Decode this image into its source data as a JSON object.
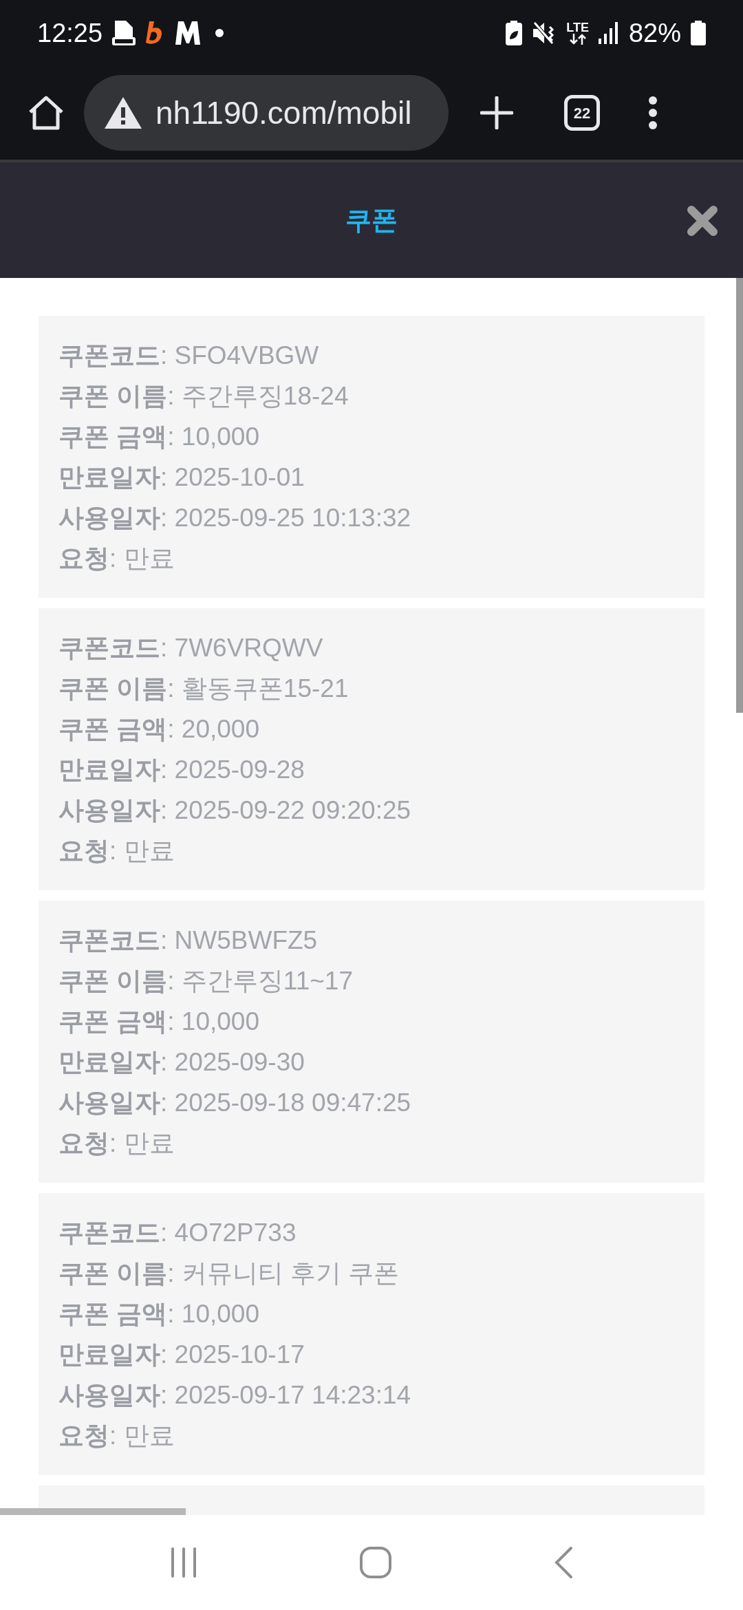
{
  "status_bar": {
    "time": "12:25",
    "network": "LTE",
    "battery": "82%"
  },
  "browser": {
    "url": "nh1190.com/mobil",
    "tab_count": "22"
  },
  "dialog": {
    "title": "쿠폰"
  },
  "coupons": [
    {
      "lines": [
        "**쿠폰코드**: SFO4VBGW",
        "**쿠폰 이름**: 주간루징18-24",
        "**쿠폰 금액**: 10,000",
        "**만료일자**: 2025-10-01",
        "**사용일자**: 2025-09-25 10:13:32",
        "**요청**: 만료"
      ]
    },
    {
      "lines": [
        "**쿠폰코드**: 7W6VRQWV",
        "**쿠폰 이름**: 활동쿠폰15-21",
        "**쿠폰 금액**: 20,000",
        "**만료일자**: 2025-09-28",
        "**사용일자**: 2025-09-22 09:20:25",
        "**요청**: 만료"
      ]
    },
    {
      "lines": [
        "**쿠폰코드**: NW5BWFZ5",
        "**쿠폰 이름**: 주간루징11~17",
        "**쿠폰 금액**: 10,000",
        "**만료일자**: 2025-09-30",
        "**사용일자**: 2025-09-18 09:47:25",
        "**요청**: 만료"
      ]
    },
    {
      "lines": [
        "**쿠폰코드**: 4O72P733",
        "**쿠폰 이름**: 커뮤니티 후기 쿠폰",
        "**쿠폰 금액**: 10,000",
        "**만료일자**: 2025-10-17",
        "**사용일자**: 2025-09-17 14:23:14",
        "**요청**: 만료"
      ]
    }
  ],
  "more_below": true
}
